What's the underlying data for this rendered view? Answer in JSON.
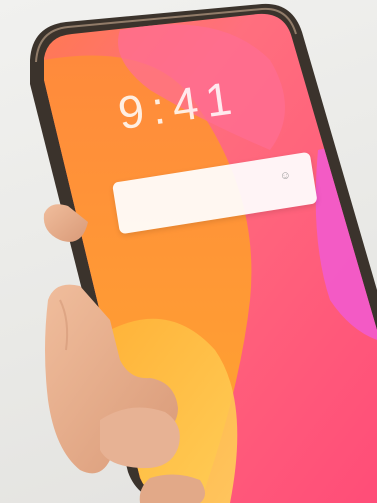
{
  "photo": {
    "subject": "hand-holding-phone",
    "colors": {
      "background": "#ecebe8",
      "frame": "#3a332d",
      "screen_orange": "#ff9a2e",
      "screen_pink": "#ff5f84",
      "screen_magenta": "#f25ad0",
      "screen_yellow": "#ffc23a",
      "skin": "#e3ab8a"
    }
  },
  "lock_screen": {
    "time": "9:41",
    "date": "",
    "notification": {
      "text": "",
      "icon": "smiley-icon"
    }
  }
}
